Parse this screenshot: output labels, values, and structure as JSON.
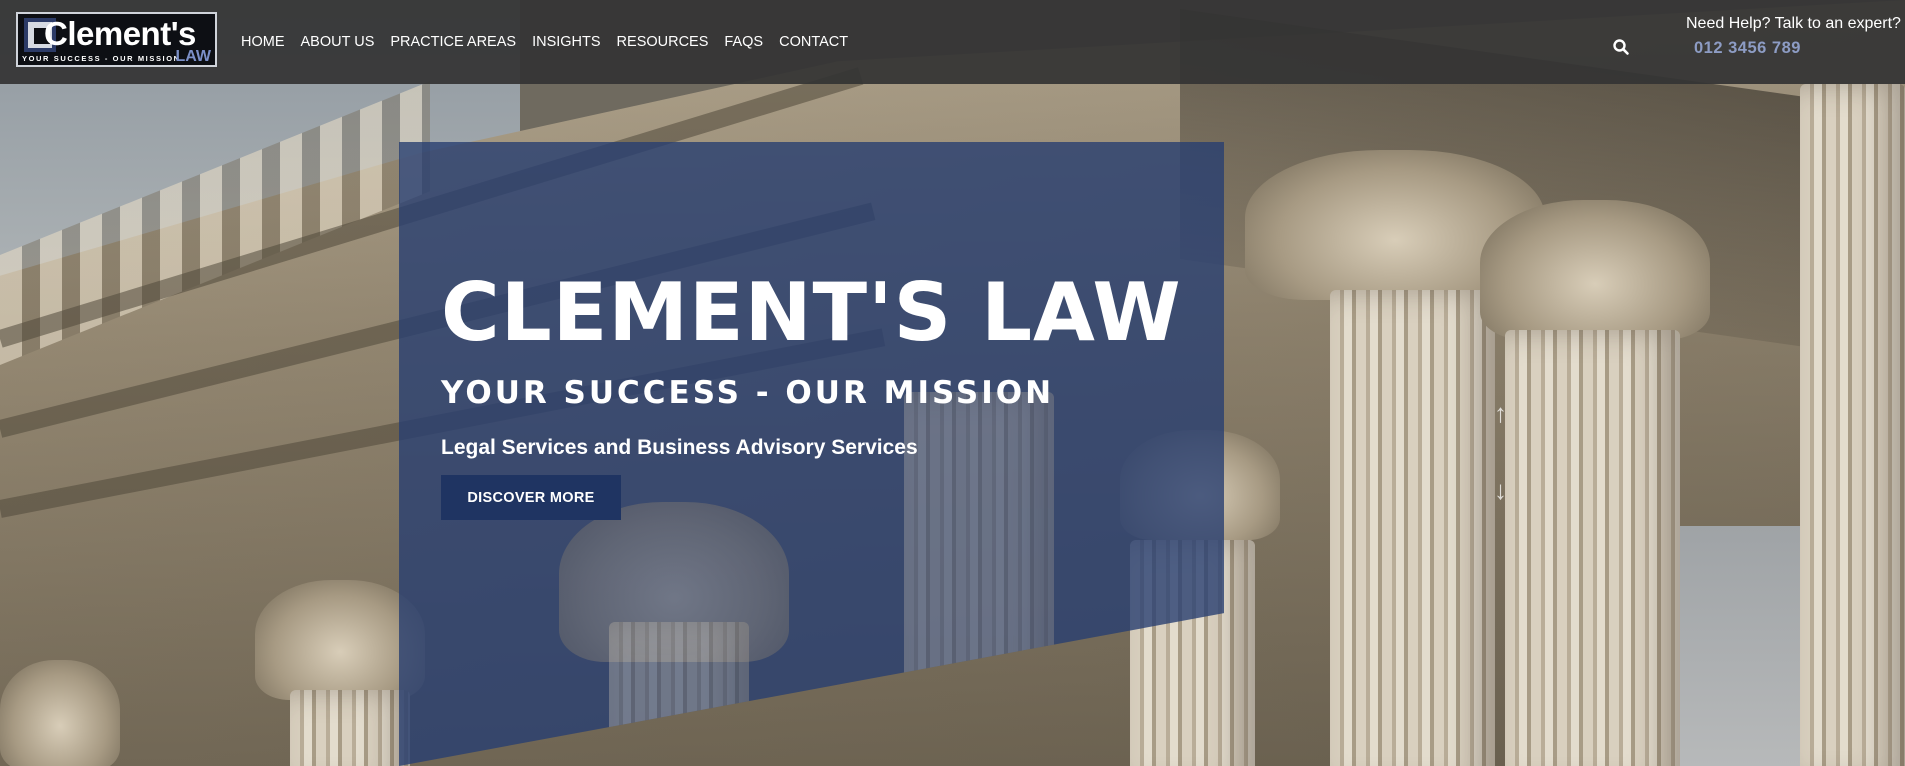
{
  "header": {
    "logo": {
      "name": "Clement's",
      "tagline": "YOUR SUCCESS - OUR MISSION",
      "law": "LAW"
    },
    "nav": [
      {
        "label": "HOME"
      },
      {
        "label": "ABOUT US"
      },
      {
        "label": "PRACTICE AREAS"
      },
      {
        "label": "INSIGHTS"
      },
      {
        "label": "RESOURCES"
      },
      {
        "label": "FAQS"
      },
      {
        "label": "CONTACT"
      }
    ],
    "search_icon": "search-icon",
    "help_text": "Need Help? Talk to an expert?",
    "phone": "012 3456 789"
  },
  "hero": {
    "title": "CLEMENT'S LAW",
    "subtitle": "YOUR SUCCESS - OUR MISSION",
    "tagline": "Legal Services and Business Advisory Services",
    "cta_label": "DISCOVER MORE",
    "slider_prev_icon": "arrow-up-icon",
    "slider_next_icon": "arrow-down-icon"
  },
  "colors": {
    "header_bg": "#343434",
    "brand_blue": "#283e70",
    "button_blue": "#1f3462",
    "phone_accent": "#8d9cc4",
    "logo_law": "#7b8fc7"
  }
}
